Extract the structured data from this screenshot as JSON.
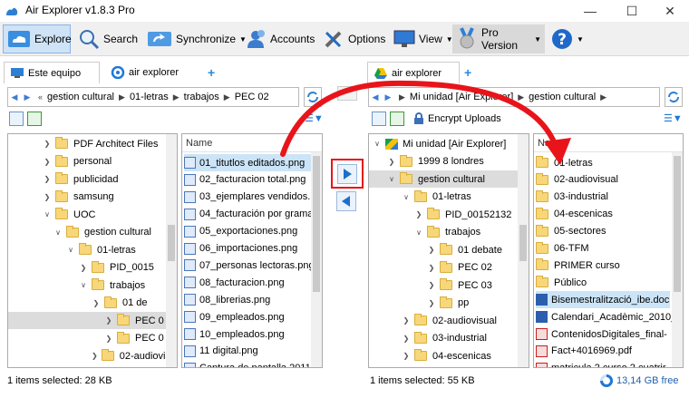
{
  "window": {
    "title": "Air Explorer v1.8.3 Pro"
  },
  "toolbar": {
    "explore": "Explore",
    "search": "Search",
    "synchronize": "Synchronize",
    "accounts": "Accounts",
    "options": "Options",
    "view": "View",
    "pro_version": "Pro Version"
  },
  "left": {
    "tabs": [
      "Este equipo",
      "air explorer"
    ],
    "path": [
      "gestion cultural",
      "01-letras",
      "trabajos",
      "PEC 02"
    ],
    "tree": [
      {
        "label": "PDF Architect Files"
      },
      {
        "label": "personal"
      },
      {
        "label": "publicidad"
      },
      {
        "label": "samsung"
      },
      {
        "label": "UOC"
      },
      {
        "label": "gestion cultural"
      },
      {
        "label": "01-letras"
      },
      {
        "label": "PID_0015"
      },
      {
        "label": "trabajos"
      },
      {
        "label": "01 de"
      },
      {
        "label": "PEC 0"
      },
      {
        "label": "PEC 0"
      },
      {
        "label": "02-audiovisu"
      }
    ],
    "list_header": "Name",
    "files": [
      "01_titutlos editados.png",
      "02_facturacion total.png",
      "03_ejemplares vendidos.png",
      "04_facturación por grama",
      "05_exportaciones.png",
      "06_importaciones.png",
      "07_personas lectoras.png",
      "08_facturacion.png",
      "08_librerias.png",
      "09_empleados.png",
      "10_empleados.png",
      "11 digital.png",
      "Captura de pantalla 2011"
    ],
    "status": "1 items selected: 28 KB"
  },
  "right": {
    "tabs": [
      "air explorer"
    ],
    "path": [
      "Mi unidad [Air Explorer]",
      "gestion cultural"
    ],
    "encrypt": "Encrypt Uploads",
    "tree": [
      {
        "label": "Mi unidad [Air Explorer]"
      },
      {
        "label": "1999 8 londres"
      },
      {
        "label": "gestion cultural"
      },
      {
        "label": "01-letras"
      },
      {
        "label": "PID_00152132"
      },
      {
        "label": "trabajos"
      },
      {
        "label": "01 debate"
      },
      {
        "label": "PEC 02"
      },
      {
        "label": "PEC 03"
      },
      {
        "label": "pp"
      },
      {
        "label": "02-audiovisual"
      },
      {
        "label": "03-industrial"
      },
      {
        "label": "04-escenicas"
      }
    ],
    "list_header": "Name",
    "files": [
      {
        "name": "01-letras",
        "type": "folder"
      },
      {
        "name": "02-audiovisual",
        "type": "folder"
      },
      {
        "name": "03-industrial",
        "type": "folder"
      },
      {
        "name": "04-escenicas",
        "type": "folder"
      },
      {
        "name": "05-sectores",
        "type": "folder"
      },
      {
        "name": "06-TFM",
        "type": "folder"
      },
      {
        "name": "PRIMER curso",
        "type": "folder"
      },
      {
        "name": "Público",
        "type": "folder"
      },
      {
        "name": "Bisemestralització_ibe.doc",
        "type": "doc"
      },
      {
        "name": "Calendari_Acadèmic_2010_",
        "type": "doc"
      },
      {
        "name": "ContenidosDigitales_final-",
        "type": "pdf"
      },
      {
        "name": "Fact+4016969.pdf",
        "type": "pdf"
      },
      {
        "name": "matricula 2 curso 2 cuatrir",
        "type": "pdf"
      }
    ],
    "status": "1 items selected: 55 KB",
    "free_space": "13,14 GB free"
  },
  "colors": {
    "accent": "#1e78d7",
    "highlight_red": "#e8141a",
    "selection": "#cce4f7"
  }
}
